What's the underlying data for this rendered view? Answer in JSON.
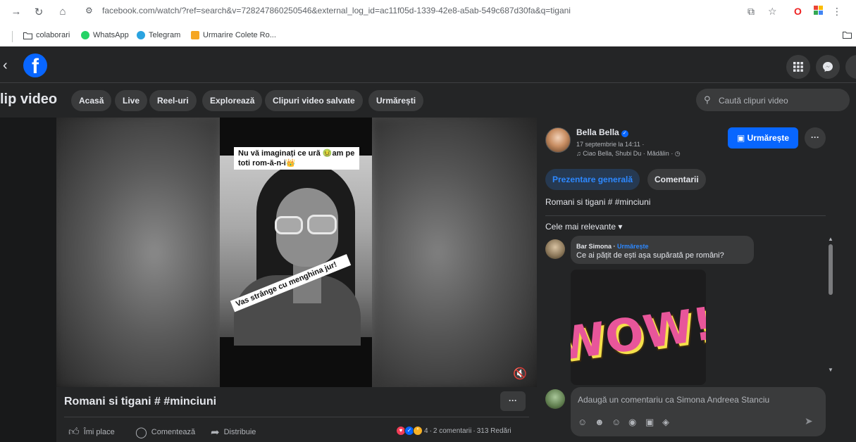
{
  "browser": {
    "url": "facebook.com/watch/?ref=search&v=728247860250546&external_log_id=ac11f05d-1339-42e8-a5ab-549c687d30fa&q=tigani",
    "bookmarks": [
      {
        "label": "colaborari",
        "icon": "folder-icon"
      },
      {
        "label": "WhatsApp",
        "icon": "whatsapp-icon",
        "color": "#25d366"
      },
      {
        "label": "Telegram",
        "icon": "telegram-icon",
        "color": "#2aa3e0"
      },
      {
        "label": "Urmarire Colete Ro...",
        "icon": "package-icon",
        "color": "#f5a623"
      }
    ]
  },
  "colors": {
    "fb_blue": "#0866ff",
    "link_blue": "#2d88ff",
    "panel": "#242526",
    "background": "#18191a"
  },
  "watch_nav": {
    "title": "lip video",
    "pills": [
      "Acasă",
      "Live",
      "Reel-uri",
      "Explorează",
      "Clipuri video salvate",
      "Urmărești"
    ],
    "search_placeholder": "Caută clipuri video"
  },
  "video": {
    "caption_top": "Nu vă imaginați ce ură 🤢am pe toti rom-ă-n-i👑",
    "caption_bottom": "Vas strânge cu menghina jur!",
    "title": "Romani si tigani # #minciuni",
    "actions": {
      "like": "Îmi place",
      "comment": "Comentează",
      "share": "Distribuie"
    },
    "reactions_count": "4",
    "comments_count": "2 comentarii",
    "views": "313 Redări"
  },
  "post": {
    "author": "Bella Bella",
    "date": "17 septembrie la 14:11 ·",
    "music": "♫ Ciao Bella, Shubi Du · Mădălin · ◷",
    "follow_label": "Urmărește",
    "tabs": [
      "Prezentare generală",
      "Comentarii"
    ],
    "description": "Romani si tigani # #minciuni",
    "sort_label": "Cele mai relevante ▾"
  },
  "comments": [
    {
      "name": "Bar Simona",
      "follow": "Urmărește",
      "text": "Ce ai pățit de ești așa supărată pe români?",
      "gif_text": "WOW!"
    }
  ],
  "composer": {
    "placeholder": "Adaugă un comentariu ca Simona Andreea Stanciu"
  }
}
